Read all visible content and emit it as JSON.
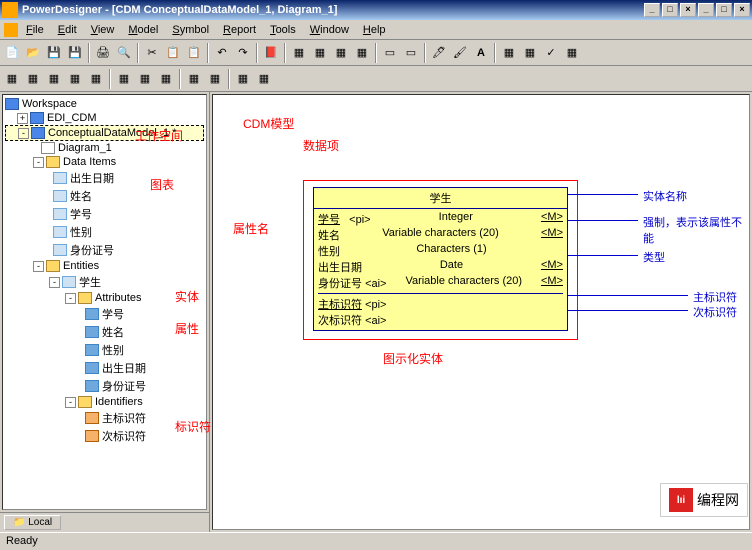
{
  "window": {
    "title": "PowerDesigner - [CDM ConceptualDataModel_1, Diagram_1]",
    "min": "_",
    "max": "□",
    "close": "×"
  },
  "menu": [
    "File",
    "Edit",
    "View",
    "Model",
    "Symbol",
    "Report",
    "Tools",
    "Window",
    "Help"
  ],
  "tree": {
    "root": "Workspace",
    "n1": "EDI_CDM",
    "n2": "ConceptualDataModel_1 *",
    "n3": "Diagram_1",
    "n4": "Data Items",
    "di": [
      "出生日期",
      "姓名",
      "学号",
      "性别",
      "身份证号"
    ],
    "n5": "Entities",
    "ent": "学生",
    "n6": "Attributes",
    "attrs": [
      "学号",
      "姓名",
      "性别",
      "出生日期",
      "身份证号"
    ],
    "n7": "Identifiers",
    "ids": [
      "主标识符",
      "次标识符"
    ]
  },
  "tab": "Local",
  "annotations": {
    "workspace": "工作空间",
    "cdm_model": "CDM模型",
    "data_items": "数据项",
    "diagram": "图表",
    "entities": "实体",
    "attributes": "属性",
    "identifiers": "标识符",
    "entity_graphic": "图示化实体",
    "attr_name": "属性名",
    "entity_name": "实体名称",
    "mandatory": "强制，表示该属性不能",
    "type": "类型",
    "pk": "主标识符",
    "ak": "次标识符"
  },
  "entity": {
    "title": "学生",
    "rows": [
      {
        "name": "学号",
        "flag": "<pi>",
        "type": "Integer",
        "m": "<M>"
      },
      {
        "name": "姓名",
        "flag": "",
        "type": "Variable characters (20)",
        "m": "<M>"
      },
      {
        "name": "性别",
        "flag": "",
        "type": "Characters (1)",
        "m": ""
      },
      {
        "name": "出生日期",
        "flag": "",
        "type": "Date",
        "m": "<M>"
      },
      {
        "name": "身份证号",
        "flag": "<ai>",
        "type": "Variable characters (20)",
        "m": "<M>"
      }
    ],
    "ids": [
      {
        "name": "主标识符",
        "flag": "<pi>"
      },
      {
        "name": "次标识符",
        "flag": "<ai>"
      }
    ]
  },
  "status": "Ready",
  "logo": "编程网"
}
